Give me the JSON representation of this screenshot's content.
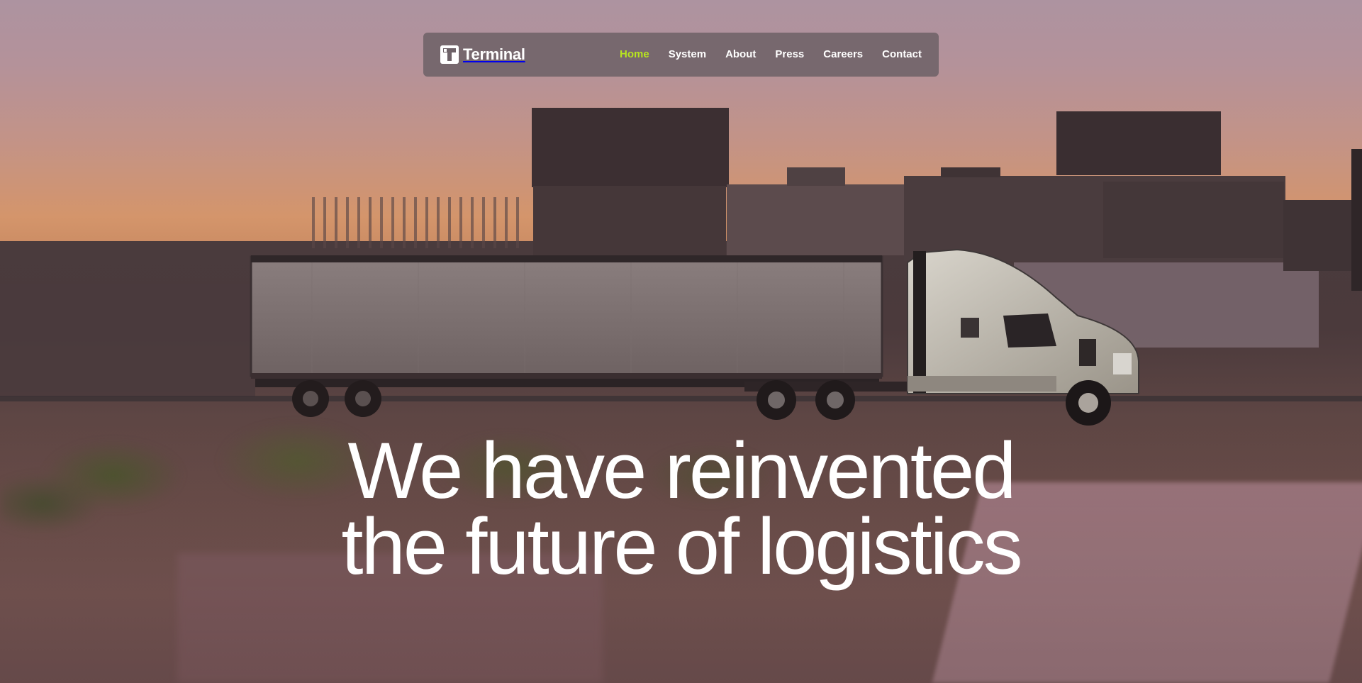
{
  "brand": {
    "name": "Terminal",
    "icon": "terminal-logo-icon"
  },
  "nav": {
    "items": [
      {
        "label": "Home",
        "active": true
      },
      {
        "label": "System",
        "active": false
      },
      {
        "label": "About",
        "active": false
      },
      {
        "label": "Press",
        "active": false
      },
      {
        "label": "Careers",
        "active": false
      },
      {
        "label": "Contact",
        "active": false
      }
    ]
  },
  "hero": {
    "headline_line1": "We have reinvented",
    "headline_line2": "the future of logistics"
  },
  "colors": {
    "accent": "#b7e51f",
    "text": "#ffffff",
    "nav_background": "#6e6268"
  }
}
